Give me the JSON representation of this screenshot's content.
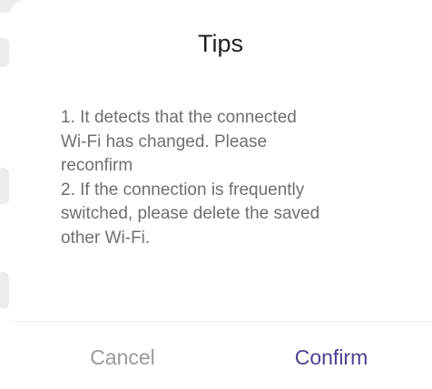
{
  "dialog": {
    "title": "Tips",
    "message_lines": [
      "1. It detects that the connected",
      "Wi-Fi has changed. Please",
      "reconfirm",
      "2. If the connection is frequently",
      "switched, please delete the saved",
      "other Wi-Fi."
    ],
    "cancel_label": "Cancel",
    "confirm_label": "Confirm"
  },
  "colors": {
    "title": "#1f1f1f",
    "message": "#6f6f6f",
    "cancel": "#9a9a9a",
    "confirm": "#4f3f8f",
    "background": "#ffffff"
  }
}
